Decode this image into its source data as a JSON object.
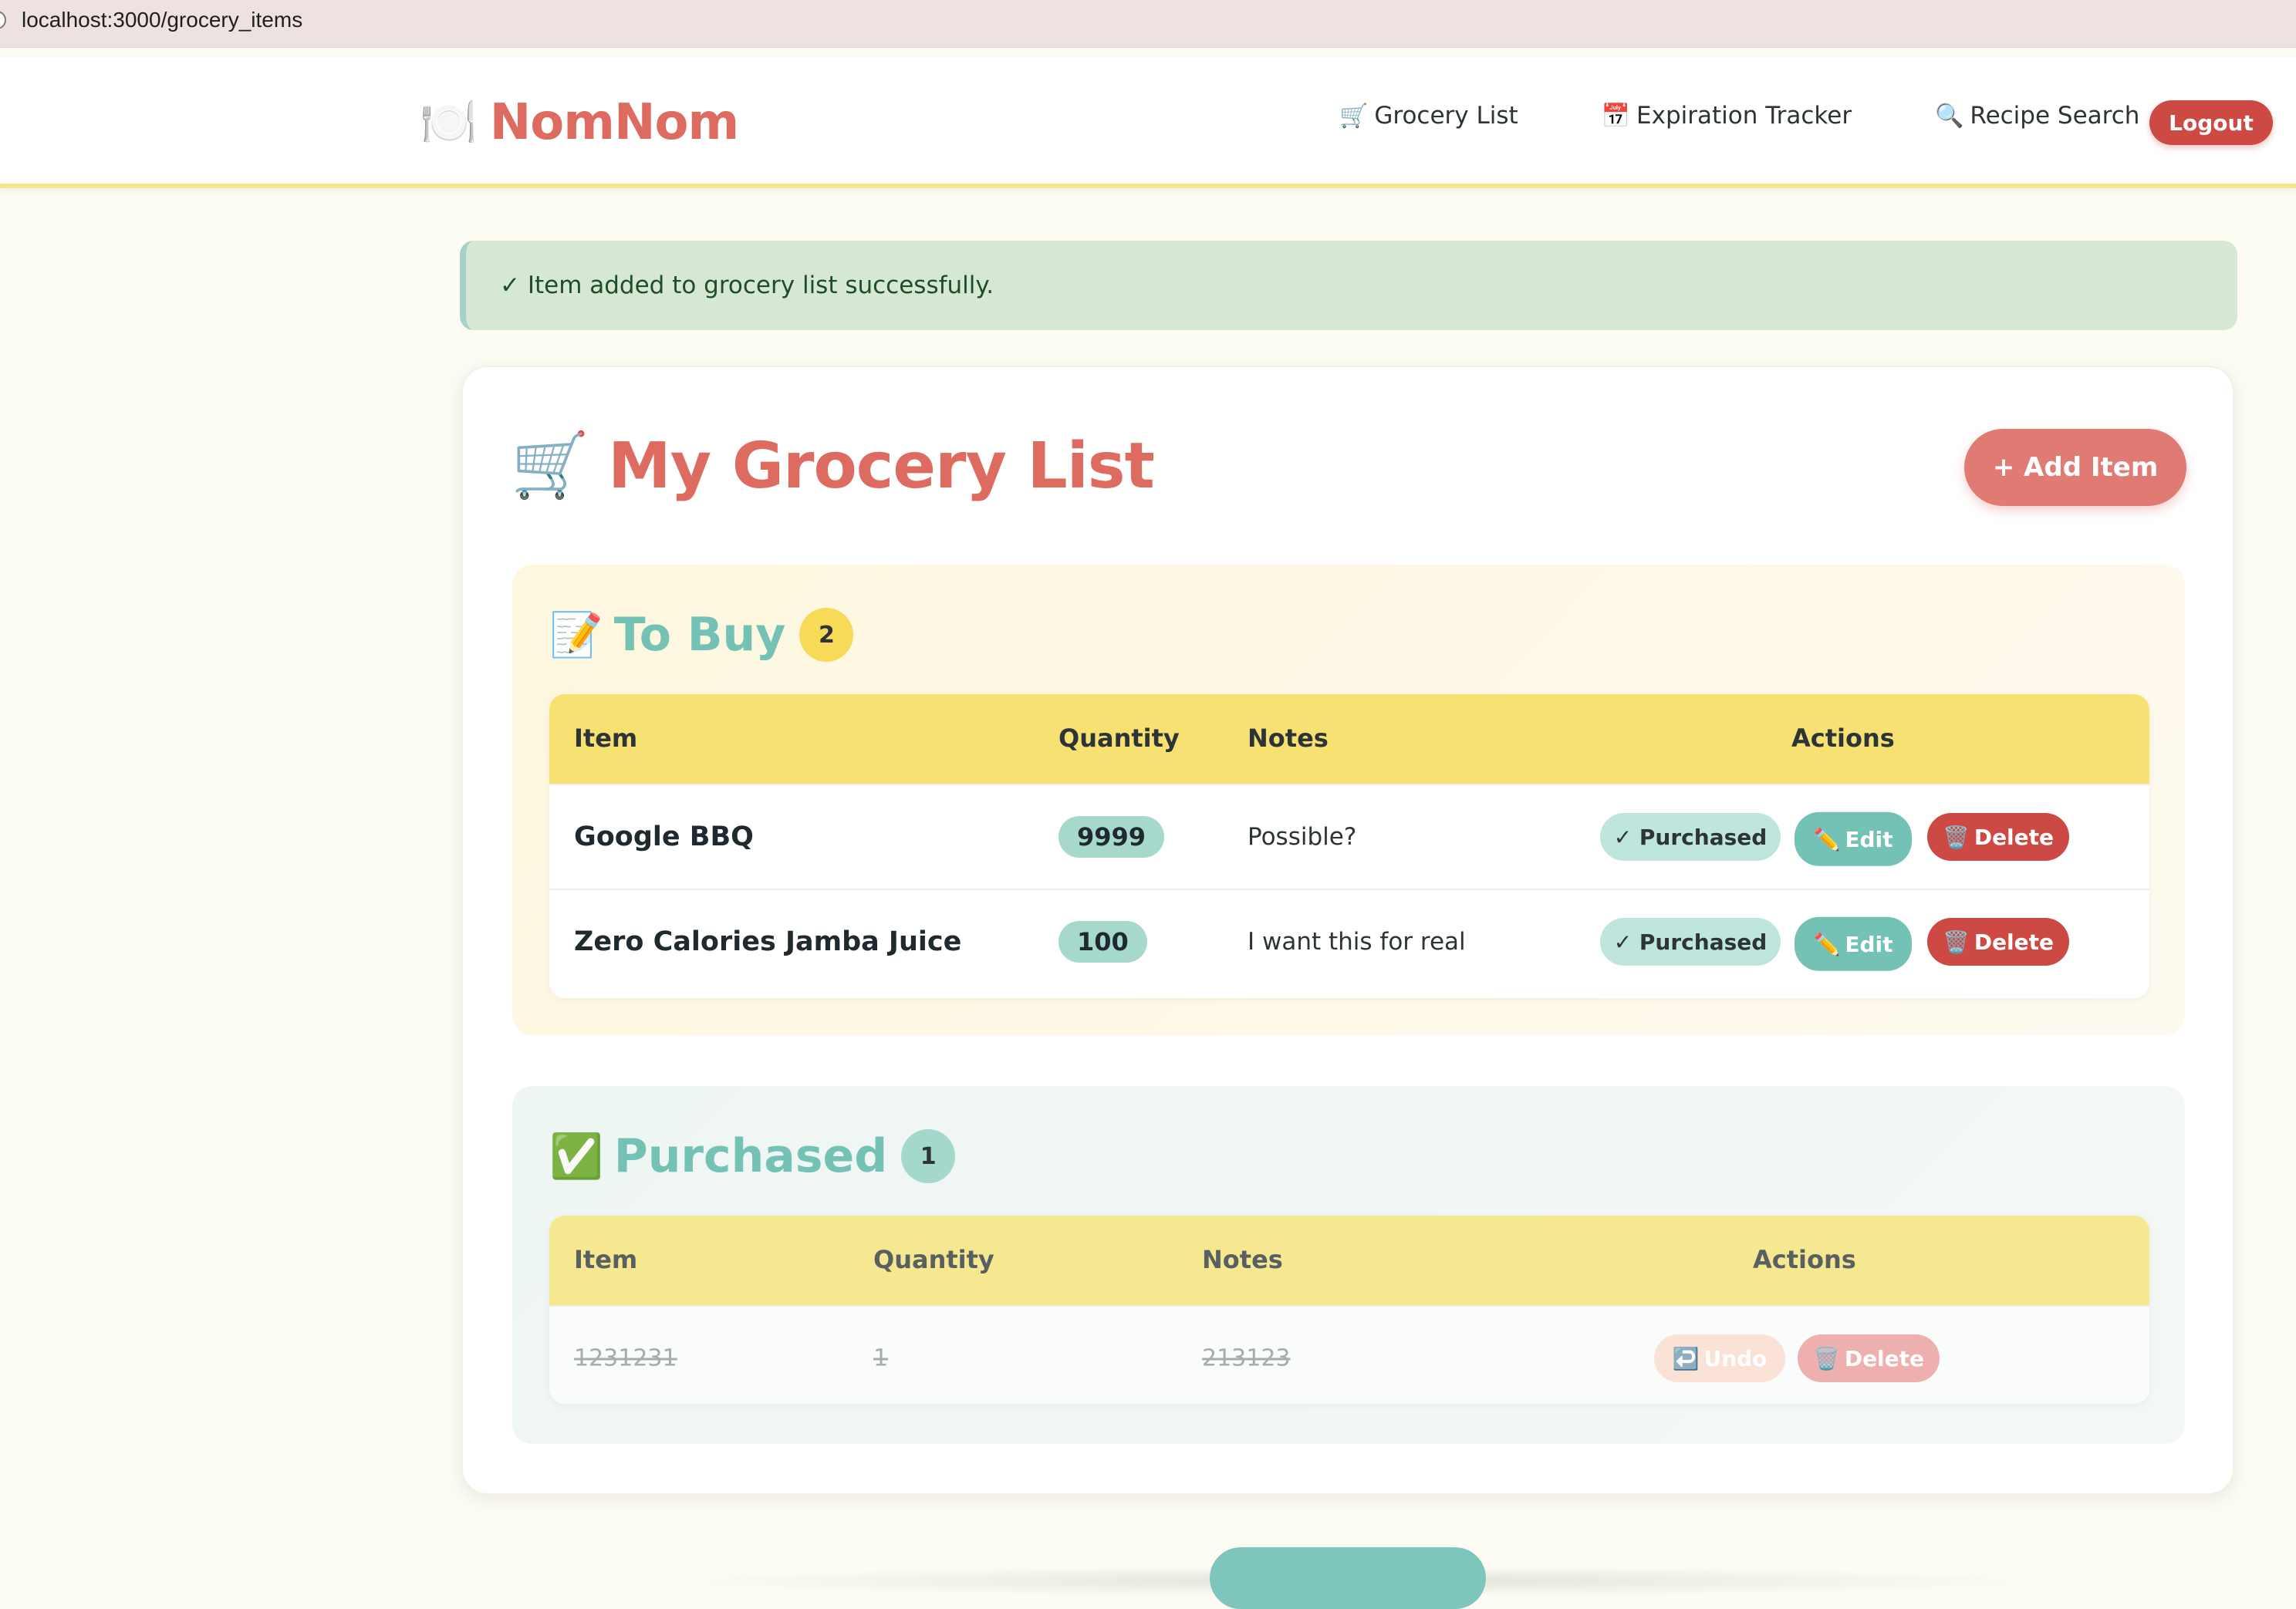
{
  "browser": {
    "url": "localhost:3000/grocery_items"
  },
  "navbar": {
    "brand_icon": "🍽️",
    "brand": "NomNom",
    "links": [
      {
        "icon": "🛒",
        "label": "Grocery List"
      },
      {
        "icon": "📅",
        "label": "Expiration Tracker"
      },
      {
        "icon": "🔍",
        "label": "Recipe Search"
      }
    ],
    "logout": "Logout"
  },
  "flash": "✓ Item added to grocery list successfully.",
  "page": {
    "title_icon": "🛒",
    "title": "My Grocery List",
    "add_button": "+ Add Item"
  },
  "to_buy": {
    "icon": "📝",
    "title": "To Buy",
    "count": "2",
    "headers": [
      "Item",
      "Quantity",
      "Notes",
      "Actions"
    ],
    "rows": [
      {
        "item": "Google BBQ",
        "quantity": "9999",
        "notes": "Possible?"
      },
      {
        "item": "Zero Calories Jamba Juice",
        "quantity": "100",
        "notes": "I want this for real"
      }
    ],
    "actions": {
      "purchased": "✓ Purchased",
      "edit_icon": "✏️",
      "edit": "Edit",
      "delete_icon": "🗑️",
      "delete": "Delete"
    }
  },
  "purchased": {
    "icon": "✅",
    "title": "Purchased",
    "count": "1",
    "headers": [
      "Item",
      "Quantity",
      "Notes",
      "Actions"
    ],
    "rows": [
      {
        "item": "1231231",
        "quantity": "1",
        "notes": "213123"
      }
    ],
    "actions": {
      "undo_icon": "↩️",
      "undo": "Undo",
      "delete_icon": "🗑️",
      "delete": "Delete"
    }
  },
  "colors": {
    "brand": "#dd6b5f",
    "teal": "#73c2b5",
    "yellow": "#f7e173",
    "danger": "#cd4a44"
  }
}
